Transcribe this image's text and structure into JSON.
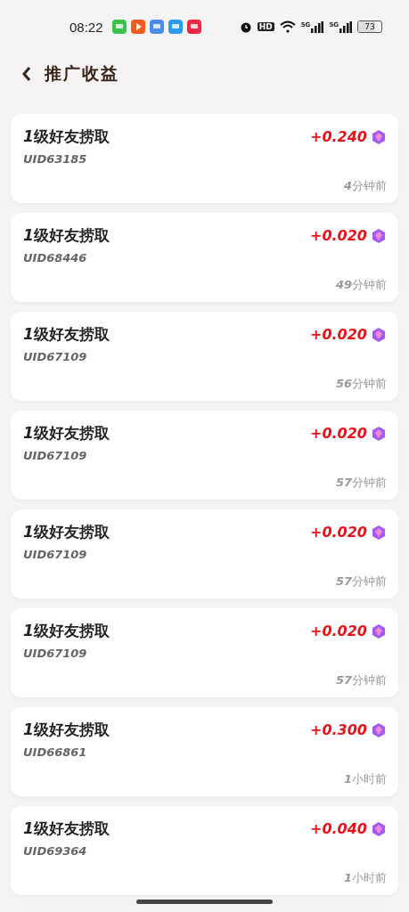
{
  "status_bar": {
    "time": "08:22",
    "hd_label": "HD",
    "signal_labels": [
      "5G",
      "5G"
    ],
    "battery": "73"
  },
  "header": {
    "title": "推广收益"
  },
  "records": [
    {
      "level_label": "1",
      "title": "级好友捞取",
      "uid": "UID63185",
      "amount": "+0.240",
      "time_num": "4",
      "time_unit": "分钟前"
    },
    {
      "level_label": "1",
      "title": "级好友捞取",
      "uid": "UID68446",
      "amount": "+0.020",
      "time_num": "49",
      "time_unit": "分钟前"
    },
    {
      "level_label": "1",
      "title": "级好友捞取",
      "uid": "UID67109",
      "amount": "+0.020",
      "time_num": "56",
      "time_unit": "分钟前"
    },
    {
      "level_label": "1",
      "title": "级好友捞取",
      "uid": "UID67109",
      "amount": "+0.020",
      "time_num": "57",
      "time_unit": "分钟前"
    },
    {
      "level_label": "1",
      "title": "级好友捞取",
      "uid": "UID67109",
      "amount": "+0.020",
      "time_num": "57",
      "time_unit": "分钟前"
    },
    {
      "level_label": "1",
      "title": "级好友捞取",
      "uid": "UID67109",
      "amount": "+0.020",
      "time_num": "57",
      "time_unit": "分钟前"
    },
    {
      "level_label": "1",
      "title": "级好友捞取",
      "uid": "UID66861",
      "amount": "+0.300",
      "time_num": "1",
      "time_unit": "小时前"
    },
    {
      "level_label": "1",
      "title": "级好友捞取",
      "uid": "UID69364",
      "amount": "+0.040",
      "time_num": "1",
      "time_unit": "小时前"
    }
  ]
}
